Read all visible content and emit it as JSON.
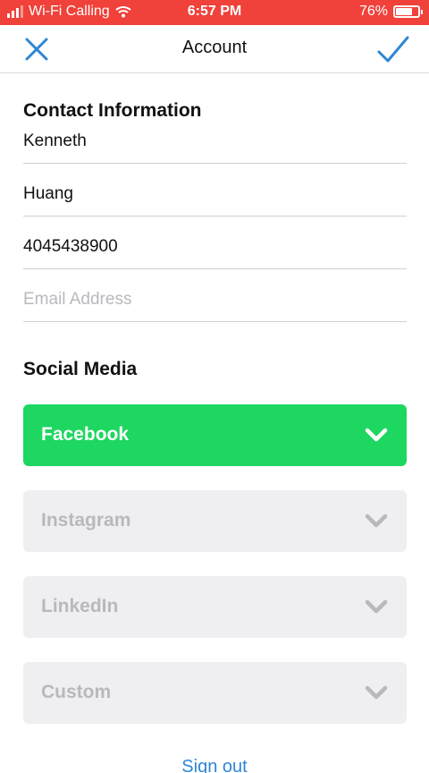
{
  "status_bar": {
    "carrier": "Wi-Fi Calling",
    "time": "6:57 PM",
    "battery": "76%",
    "battery_level": 0.76,
    "background": "#f0413a"
  },
  "nav": {
    "title": "Account",
    "close_icon": "close-x-icon",
    "done_icon": "checkmark-icon",
    "accent": "#2f86d4"
  },
  "contact": {
    "heading": "Contact Information",
    "first_name": "Kenneth",
    "last_name": "Huang",
    "phone": "4045438900",
    "email_placeholder": "Email Address",
    "email": ""
  },
  "social": {
    "heading": "Social Media",
    "items": [
      {
        "label": "Facebook",
        "active": true,
        "icon": "chevron-down-icon"
      },
      {
        "label": "Instagram",
        "active": false,
        "icon": "chevron-down-icon"
      },
      {
        "label": "LinkedIn",
        "active": false,
        "icon": "chevron-down-icon"
      },
      {
        "label": "Custom",
        "active": false,
        "icon": "chevron-down-icon"
      }
    ],
    "active_color": "#1ed760",
    "inactive_color": "#efeff1"
  },
  "footer": {
    "sign_out": "Sign out"
  }
}
